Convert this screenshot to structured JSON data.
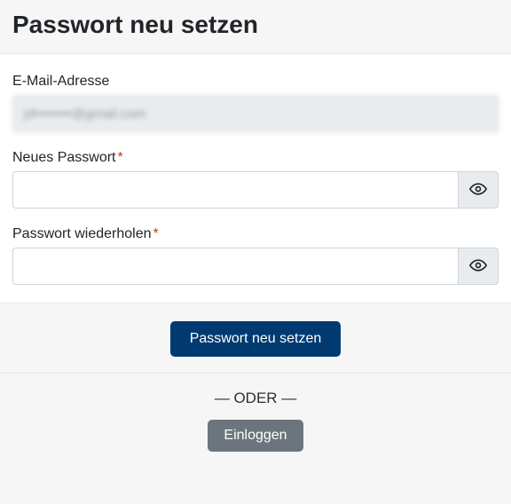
{
  "page": {
    "title": "Passwort neu setzen"
  },
  "email": {
    "label": "E-Mail-Adresse",
    "value": "jd••••••••@gmail.com"
  },
  "new_password": {
    "label": "Neues Passwort",
    "required_marker": "*",
    "value": ""
  },
  "repeat_password": {
    "label": "Passwort wiederholen",
    "required_marker": "*",
    "value": ""
  },
  "submit": {
    "label": "Passwort neu setzen"
  },
  "alt": {
    "divider_text": "— ODER —",
    "login_label": "Einloggen"
  }
}
